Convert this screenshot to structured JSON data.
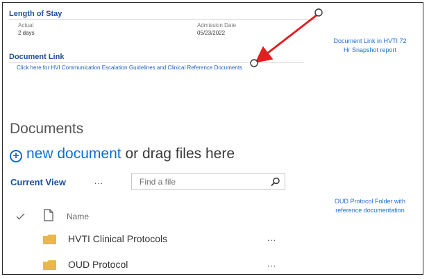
{
  "length_of_stay": {
    "title": "Length of Stay",
    "actual_label": "Actual",
    "actual_value": "2 days",
    "admission_label": "Admission Date",
    "admission_value": "05/23/2022"
  },
  "document_link": {
    "title": "Document Link",
    "link_text": "Click here for HVI Communication Escalation Guidelines and Clinical Reference Documents"
  },
  "annotations": {
    "note1_line1": "Document Link in HVTI 72",
    "note1_line2": "Hr Snapshot report",
    "note2_line1": "OUD Protocol Folder with",
    "note2_line2": "reference documentation",
    "arrow_color": "#e02020"
  },
  "documents": {
    "heading": "Documents",
    "new_document": "new document",
    "drag_text": "or drag files here",
    "current_view": "Current View",
    "view_menu": "...",
    "search_placeholder": "Find a file",
    "columns": {
      "name": "Name"
    },
    "rows": [
      {
        "name": "HVTI Clinical Protocols",
        "icon": "folder-icon",
        "menu": "..."
      },
      {
        "name": "OUD Protocol",
        "icon": "folder-icon",
        "menu": "..."
      }
    ],
    "accent_color": "#0a6fd6",
    "folder_color": "#e8b84a"
  }
}
